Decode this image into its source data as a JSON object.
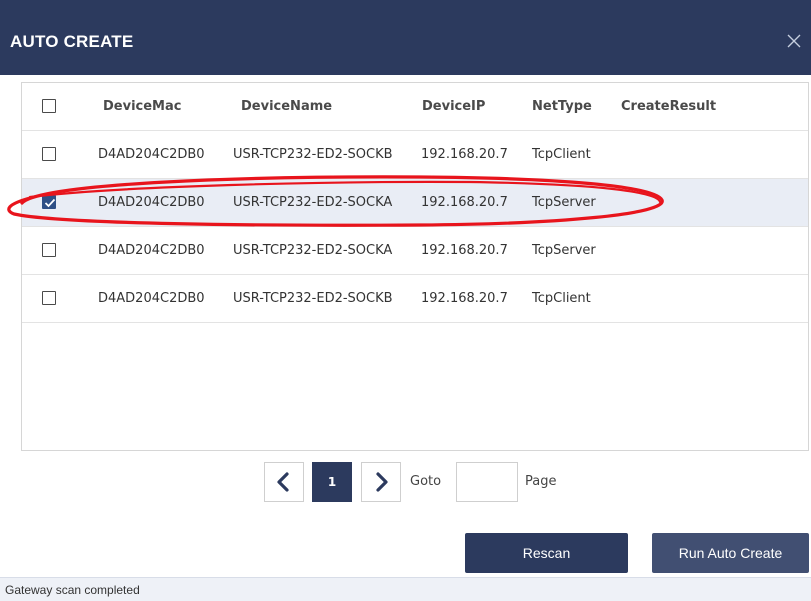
{
  "dialog": {
    "title": "AUTO CREATE",
    "close_icon": "close-icon"
  },
  "table": {
    "columns": [
      "DeviceMac",
      "DeviceName",
      "DeviceIP",
      "NetType",
      "CreateResult"
    ],
    "rows": [
      {
        "checked": false,
        "mac": "D4AD204C2DB0",
        "name": "USR-TCP232-ED2-SOCKB",
        "ip": "192.168.20.7",
        "nettype": "TcpClient",
        "result": ""
      },
      {
        "checked": true,
        "mac": "D4AD204C2DB0",
        "name": "USR-TCP232-ED2-SOCKA",
        "ip": "192.168.20.7",
        "nettype": "TcpServer",
        "result": ""
      },
      {
        "checked": false,
        "mac": "D4AD204C2DB0",
        "name": "USR-TCP232-ED2-SOCKA",
        "ip": "192.168.20.7",
        "nettype": "TcpServer",
        "result": ""
      },
      {
        "checked": false,
        "mac": "D4AD204C2DB0",
        "name": "USR-TCP232-ED2-SOCKB",
        "ip": "192.168.20.7",
        "nettype": "TcpClient",
        "result": ""
      }
    ],
    "select_all_checked": false
  },
  "pager": {
    "current_page": "1",
    "goto_label": "Goto",
    "goto_value": "",
    "page_label": "Page",
    "prev_icon": "chevron-left-icon",
    "next_icon": "chevron-right-icon"
  },
  "buttons": {
    "rescan": "Rescan",
    "run_auto_create": "Run Auto Create"
  },
  "status": {
    "text": "Gateway scan completed"
  },
  "colors": {
    "titlebar": "#2c3a5e",
    "selected_row": "#e9edf5",
    "annotation": "#e8141c"
  }
}
